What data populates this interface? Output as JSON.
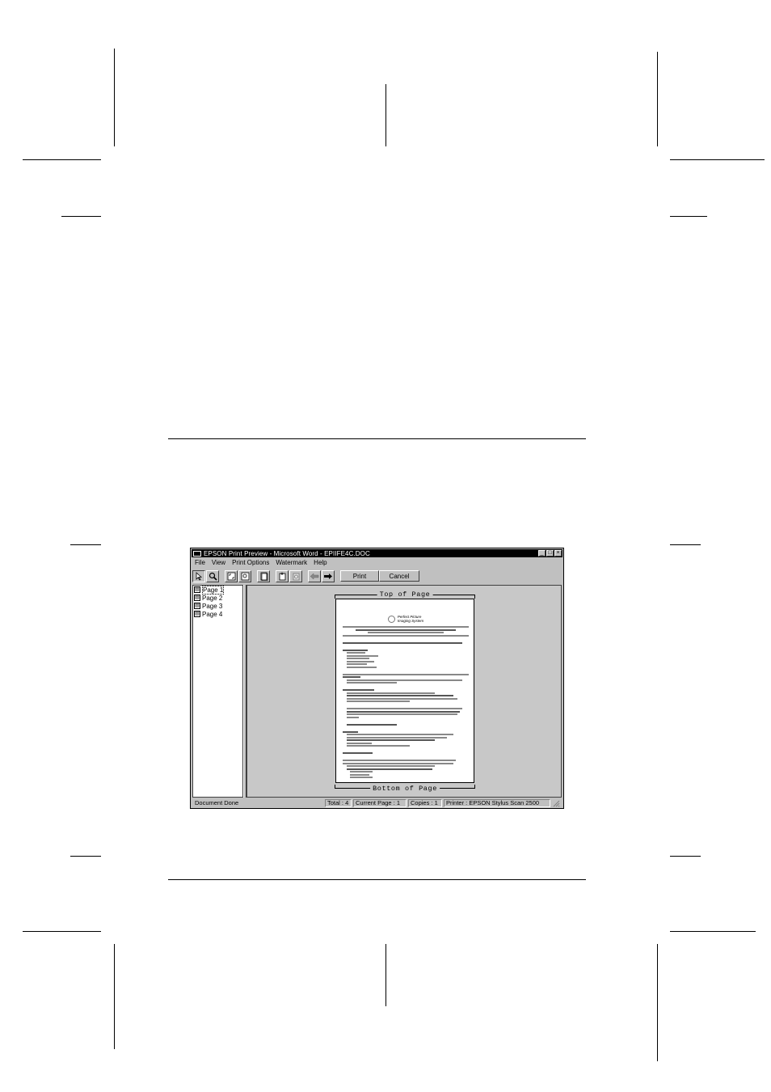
{
  "window": {
    "title": "EPSON Print Preview - Microsoft Word - EPIIFE4C.DOC",
    "minimize": "_",
    "maximize": "□",
    "close": "×"
  },
  "menu": [
    "File",
    "View",
    "Print Options",
    "Watermark",
    "Help"
  ],
  "toolbar": {
    "print_label": "Print",
    "cancel_label": "Cancel",
    "icons": [
      "arrow-pointer-icon",
      "magnifier-icon",
      "fit-page-icon",
      "zoom-box-icon",
      "page-icon",
      "add-page-icon",
      "remove-page-icon",
      "back-arrow-icon",
      "forward-arrow-icon"
    ]
  },
  "pages": [
    "Page 1",
    "Page 2",
    "Page 3",
    "Page 4"
  ],
  "preview": {
    "top_label": "Top of Page",
    "bottom_label": "Bottom of Page",
    "logo_text_1": "Perfect Picture",
    "logo_text_2": "Imaging System"
  },
  "status": {
    "message": "Document Done",
    "total": "Total : 4",
    "current_page": "Current Page : 1",
    "copies": "Copies : 1",
    "printer": "Printer : EPSON Stylus Scan 2500"
  }
}
